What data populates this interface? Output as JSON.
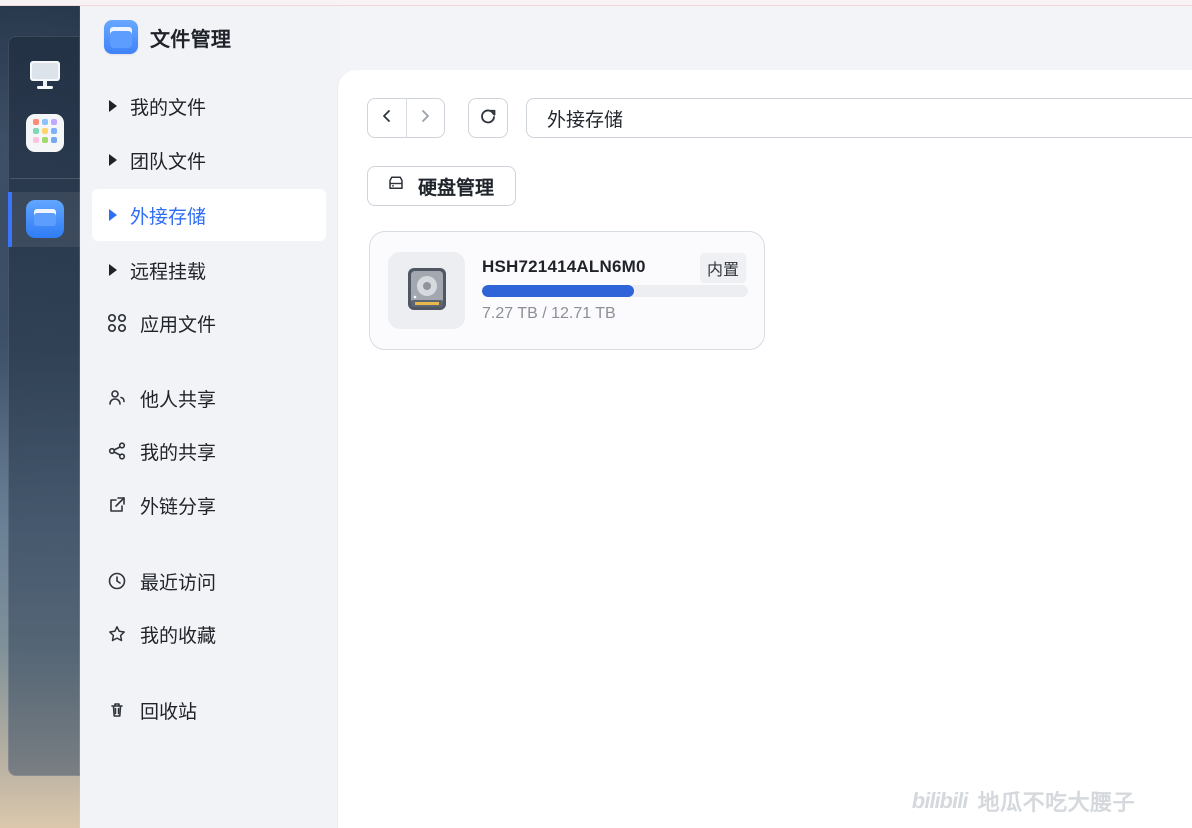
{
  "app": {
    "title": "文件管理"
  },
  "dock": {
    "items": [
      {
        "name": "desktop",
        "icon": "monitor-icon"
      },
      {
        "name": "launcher",
        "icon": "grid-app-icon"
      },
      {
        "name": "file-manager",
        "icon": "folder-app-icon",
        "active": true
      }
    ]
  },
  "sidebar": {
    "items": [
      {
        "label": "我的文件",
        "icon": "chevron-right-icon",
        "active": false
      },
      {
        "label": "团队文件",
        "icon": "chevron-right-icon",
        "active": false
      },
      {
        "label": "外接存储",
        "icon": "chevron-right-icon",
        "active": true
      },
      {
        "label": "远程挂载",
        "icon": "chevron-right-icon",
        "active": false
      },
      {
        "label": "应用文件",
        "icon": "apps-icon",
        "active": false
      },
      {
        "label": "他人共享",
        "icon": "shared-user-icon",
        "active": false
      },
      {
        "label": "我的共享",
        "icon": "share-icon",
        "active": false
      },
      {
        "label": "外链分享",
        "icon": "external-share-icon",
        "active": false
      },
      {
        "label": "最近访问",
        "icon": "clock-icon",
        "active": false
      },
      {
        "label": "我的收藏",
        "icon": "star-icon",
        "active": false
      },
      {
        "label": "回收站",
        "icon": "trash-icon",
        "active": false
      }
    ]
  },
  "toolbar": {
    "back_icon": "chevron-left-icon",
    "forward_icon": "chevron-right-icon",
    "refresh_icon": "refresh-icon",
    "path": "外接存储",
    "disk_manage_label": "硬盘管理",
    "disk_manage_icon": "drive-icon"
  },
  "storage": {
    "disk": {
      "name": "HSH721414ALN6M0",
      "badge": "内置",
      "usage_text": "7.27 TB / 12.71 TB",
      "usage_fraction": 0.572,
      "icon": "hard-drive-icon"
    }
  },
  "colors": {
    "accent": "#2f6df5",
    "usage": "#2e64d8",
    "sidebar_active_bg": "#ffffff"
  },
  "watermark": {
    "brand": "bilibili",
    "text": "地瓜不吃大腰子"
  }
}
